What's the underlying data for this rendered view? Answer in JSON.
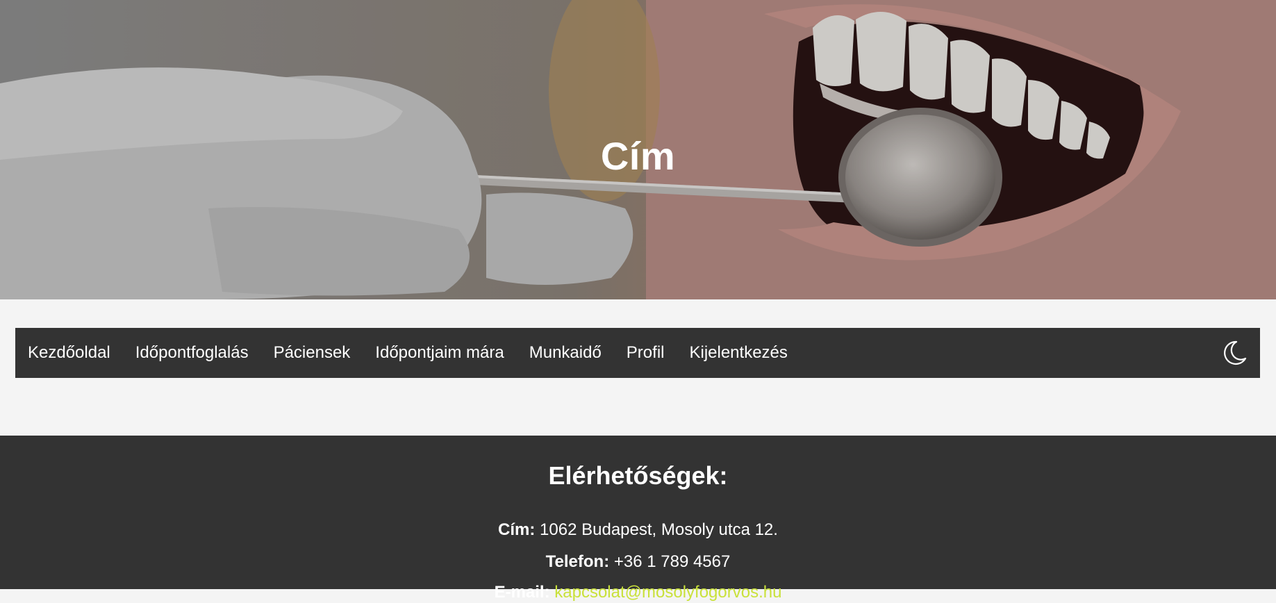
{
  "hero": {
    "title": "Cím"
  },
  "nav": {
    "items": [
      {
        "label": "Kezdőoldal"
      },
      {
        "label": "Időpontfoglalás"
      },
      {
        "label": "Páciensek"
      },
      {
        "label": "Időpontjaim mára"
      },
      {
        "label": "Munkaidő"
      },
      {
        "label": "Profil"
      },
      {
        "label": "Kijelentkezés"
      }
    ],
    "theme_toggle_icon": "moon-icon"
  },
  "footer": {
    "heading": "Elérhetőségek:",
    "address_label": "Cím:",
    "address_value": " 1062 Budapest, Mosoly utca 12.",
    "phone_label": "Telefon:",
    "phone_value": " +36 1 789 4567",
    "email_label": "E-mail:",
    "email_value": " kapcsolat@mosolyfogorvos.hu"
  },
  "colors": {
    "nav_bg": "#333333",
    "footer_bg": "#333333",
    "page_bg": "#f4f4f4",
    "link_accent": "#c9e13b"
  }
}
